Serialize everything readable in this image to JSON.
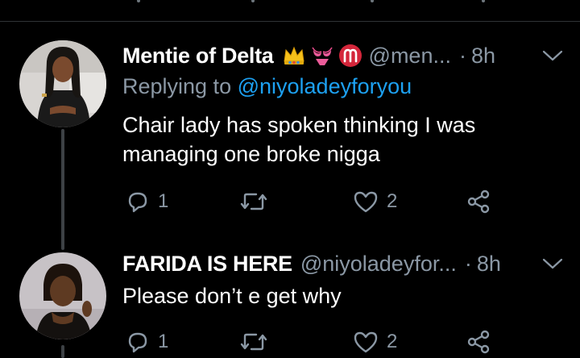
{
  "app": {
    "theme": "dark",
    "accent_color": "#1da1f2",
    "muted_color": "#8b98a5"
  },
  "tweets": [
    {
      "display_name": "Mentie of Delta",
      "badges": [
        "crown-emoji",
        "bikini-emoji",
        "aries-emoji"
      ],
      "handle": "@men...",
      "separator": "·",
      "time": "8h",
      "reply_prefix": "Replying to ",
      "reply_mention": "@niyoladeyforyou",
      "text": "Chair lady has spoken thinking I was managing one broke nigga",
      "reply_count": "1",
      "retweet_count": "",
      "like_count": "2"
    },
    {
      "display_name": "FARIDA IS HERE",
      "badges": [],
      "handle": "@niyoladeyfor...",
      "separator": "·",
      "time": "8h",
      "text": "Please don’t e get why",
      "reply_count": "1",
      "retweet_count": "",
      "like_count": "2"
    }
  ]
}
